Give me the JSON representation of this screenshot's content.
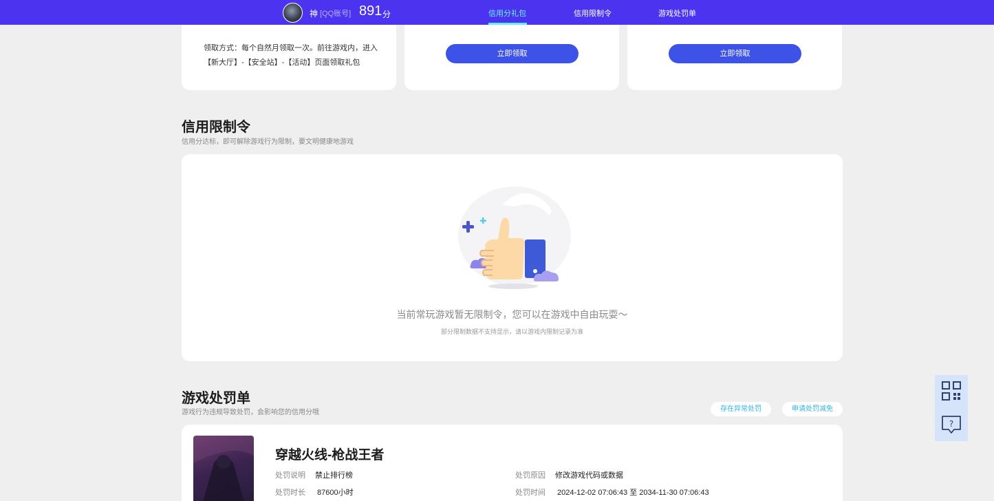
{
  "header": {
    "username": "神",
    "account_tag": "[QQ账号]",
    "score": "891",
    "score_unit": "分",
    "tabs": [
      {
        "label": "信用分礼包",
        "active": true
      },
      {
        "label": "信用限制令",
        "active": false
      },
      {
        "label": "游戏处罚单",
        "active": false
      }
    ]
  },
  "gift": {
    "claim_desc": "领取方式：每个自然月领取一次。前往游戏内，进入【新大厅】-【安全站】-【活动】页面领取礼包",
    "claim_button": "立即领取"
  },
  "restriction": {
    "title": "信用限制令",
    "subtitle": "信用分达标，即可解除游戏行为限制，要文明健康地游戏",
    "empty_message": "当前常玩游戏暂无限制令，您可以在游戏中自由玩耍～",
    "empty_note": "部分限制数据不支持显示，请以游戏内限制记录为准"
  },
  "penalty": {
    "title": "游戏处罚单",
    "subtitle": "游戏行为违规导致处罚，会影响您的信用分哦",
    "abnormal_button": "存在异常处罚",
    "appeal_button": "申请处罚减免",
    "game_title": "穿越火线-枪战王者",
    "labels": {
      "desc": "处罚说明",
      "duration": "处罚时长",
      "reason": "处罚原因",
      "time": "处罚时间"
    },
    "values": {
      "desc": "禁止排行榜",
      "duration": "87600小时",
      "reason": "修改游戏代码或数据",
      "time": "2024-12-02 07:06:43 至 2034-11-30 07:06:43"
    }
  },
  "colors": {
    "brand": "#4b33f0",
    "button": "#3d53e8",
    "accent": "#62ecff",
    "link": "#32b6e6"
  },
  "icons": {
    "qr": "qr-code-icon",
    "help": "help-chat-icon",
    "empty": "thumbs-up-illustration"
  }
}
